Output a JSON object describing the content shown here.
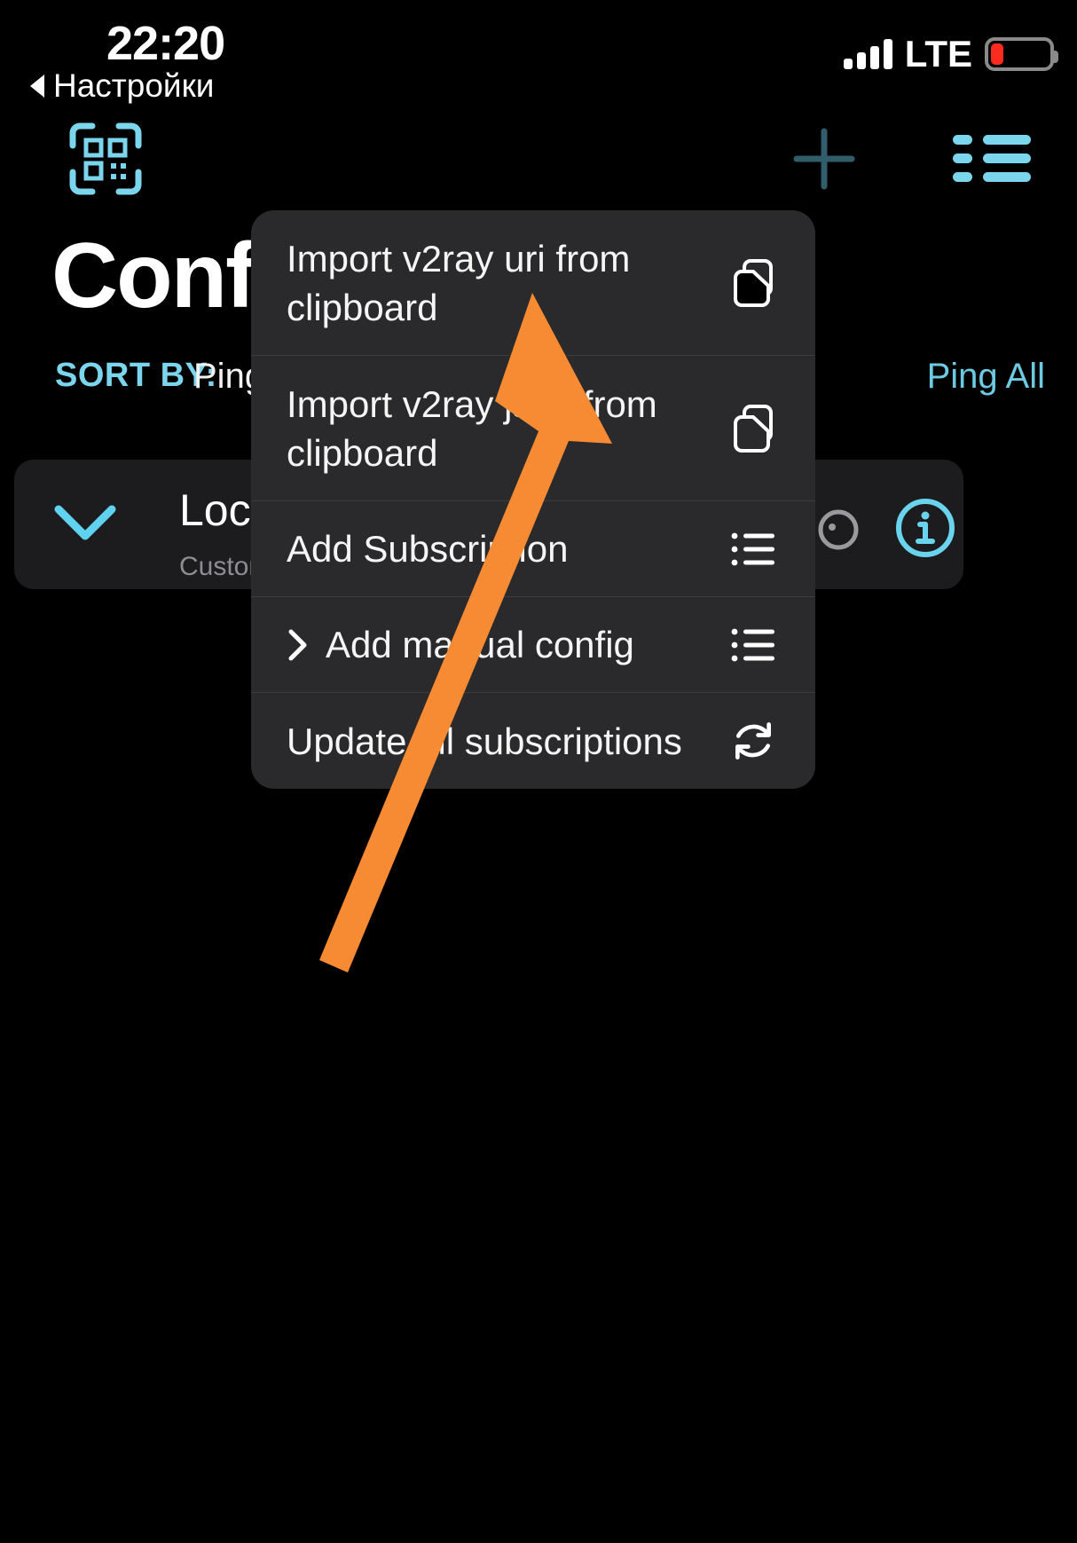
{
  "status_bar": {
    "time": "22:20",
    "carrier_network": "LTE",
    "signal_icon": "signal-bars-icon",
    "battery_icon": "battery-low-icon",
    "battery_color": "#fb2b20",
    "signal_bars": 4
  },
  "back_link": {
    "label": "Настройки",
    "icon": "back-caret-icon"
  },
  "nav_bar": {
    "qr_icon": "qr-scan-icon",
    "add_icon": "plus-icon",
    "menu_icon": "list-bullet-icon",
    "accent_color": "#7bd5ed",
    "add_icon_color": "#2f5d69"
  },
  "page": {
    "title": "Config"
  },
  "sort_row": {
    "label": "SORT BY:",
    "value": "Ping",
    "ping_all_label": "Ping All",
    "label_color": "#7bd5ed"
  },
  "config_card": {
    "expand_icon": "chevron-down-icon",
    "title": "Local",
    "subtitle": "Custom c",
    "speed_icon": "speedometer-icon",
    "info_icon": "info-circle-icon",
    "background": "#1c1c1e"
  },
  "popover_menu": {
    "background": "#2a2a2c",
    "items": [
      {
        "label": "Import v2ray uri from clipboard",
        "icon": "doc-on-doc-icon",
        "has_submenu": false
      },
      {
        "label": "Import v2ray json from clipboard",
        "icon": "doc-on-doc-icon",
        "has_submenu": false
      },
      {
        "label": "Add Subscription",
        "icon": "list-bullet-icon",
        "has_submenu": false
      },
      {
        "label": "Add manual config",
        "icon": "list-bullet-icon",
        "has_submenu": true,
        "submenu_icon": "chevron-right-icon"
      },
      {
        "label": "Update all subscriptions",
        "icon": "refresh-circle-icon",
        "has_submenu": false
      }
    ]
  },
  "annotation": {
    "arrow_color": "#F68B33",
    "arrow_name": "orange-pointer-arrow",
    "points_to": "Import v2ray uri from clipboard"
  }
}
